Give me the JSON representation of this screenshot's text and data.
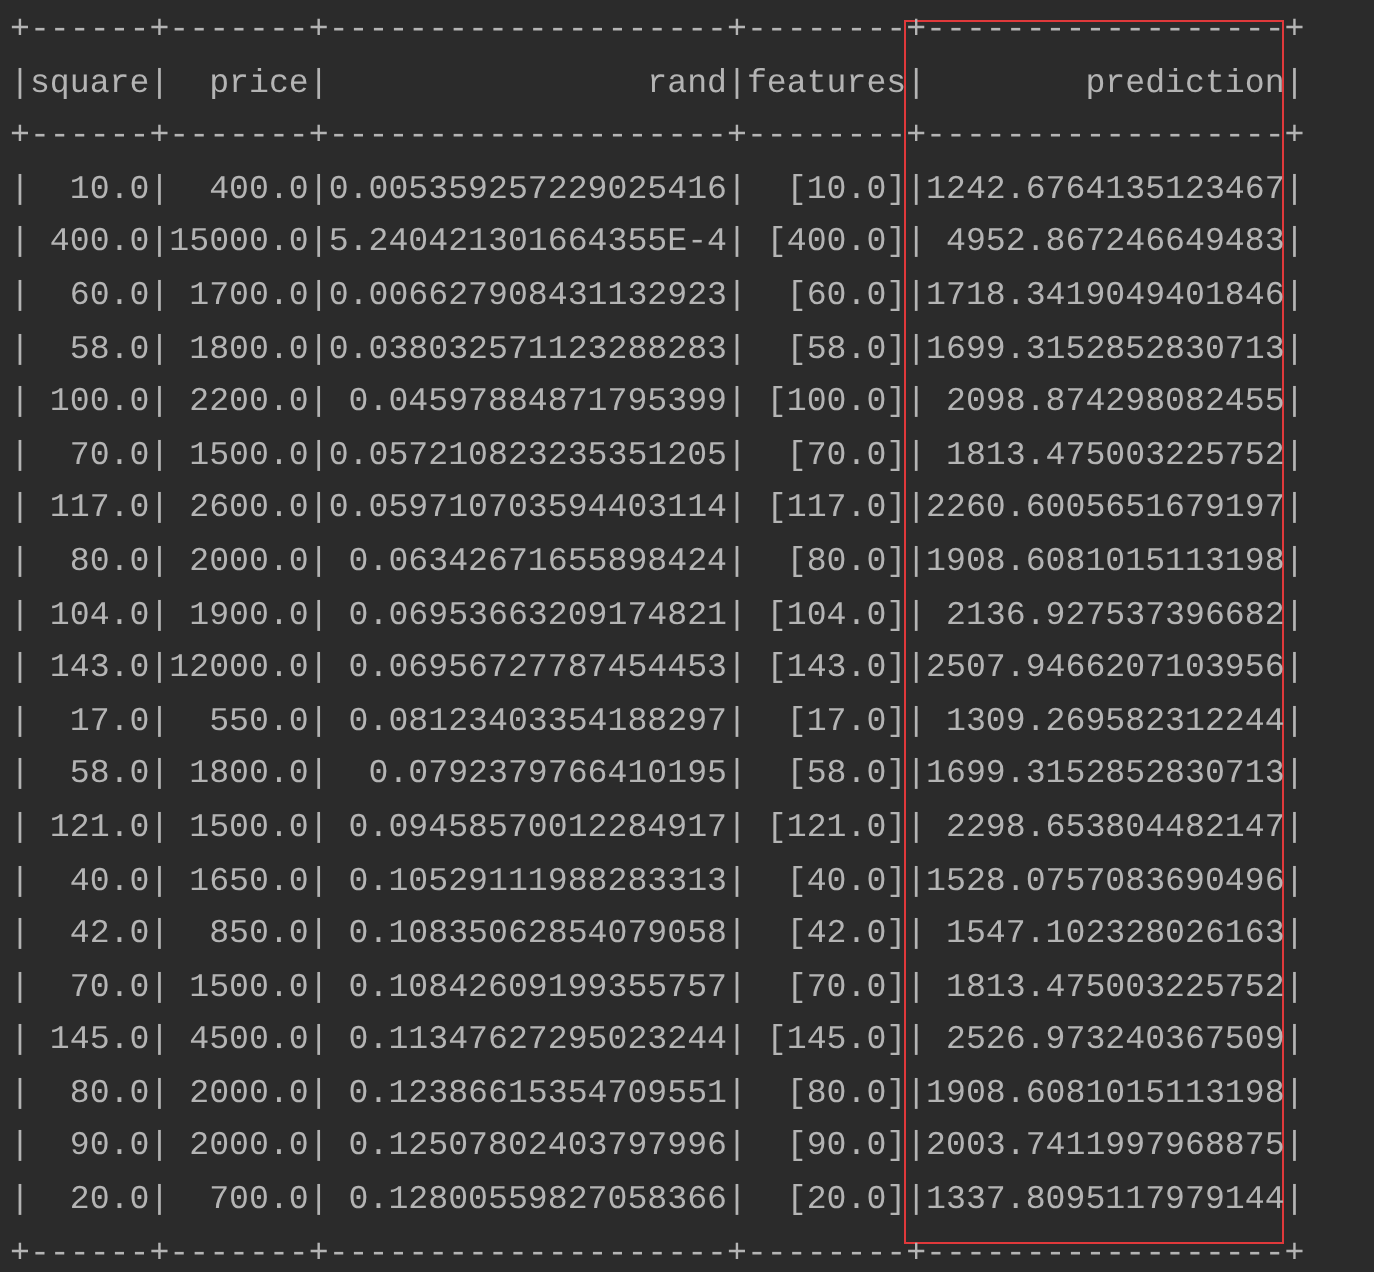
{
  "console_lines": [
    "+------+-------+--------------------+--------+------------------+",
    "|square|  price|                rand|features|        prediction|",
    "+------+-------+--------------------+--------+------------------+",
    "|  10.0|  400.0|0.005359257229025416|  [10.0]|1242.6764135123467|",
    "| 400.0|15000.0|5.240421301664355E-4| [400.0]| 4952.867246649483|",
    "|  60.0| 1700.0|0.006627908431132923|  [60.0]|1718.3419049401846|",
    "|  58.0| 1800.0|0.038032571123288283|  [58.0]|1699.3152852830713|",
    "| 100.0| 2200.0| 0.04597884871795399| [100.0]| 2098.874298082455|",
    "|  70.0| 1500.0|0.057210823235351205|  [70.0]| 1813.475003225752|",
    "| 117.0| 2600.0|0.059710703594403114| [117.0]|2260.6005651679197|",
    "|  80.0| 2000.0| 0.06342671655898424|  [80.0]|1908.6081015113198|",
    "| 104.0| 1900.0| 0.06953663209174821| [104.0]| 2136.927537396682|",
    "| 143.0|12000.0| 0.06956727787454453| [143.0]|2507.9466207103956|",
    "|  17.0|  550.0| 0.08123403354188297|  [17.0]| 1309.269582312244|",
    "|  58.0| 1800.0|  0.0792379766410195|  [58.0]|1699.3152852830713|",
    "| 121.0| 1500.0| 0.09458570012284917| [121.0]| 2298.653804482147|",
    "|  40.0| 1650.0| 0.10529111988283313|  [40.0]|1528.0757083690496|",
    "|  42.0|  850.0| 0.10835062854079058|  [42.0]| 1547.102328026163|",
    "|  70.0| 1500.0| 0.10842609199355757|  [70.0]| 1813.475003225752|",
    "| 145.0| 4500.0| 0.11347627295023244| [145.0]| 2526.973240367509|",
    "|  80.0| 2000.0| 0.12386615354709551|  [80.0]|1908.6081015113198|",
    "|  90.0| 2000.0| 0.12507802403797996|  [90.0]|2003.7411997968875|",
    "|  20.0|  700.0| 0.12800559827058366|  [20.0]|1337.8095117979144|",
    "+------+-------+--------------------+--------+------------------+"
  ]
}
